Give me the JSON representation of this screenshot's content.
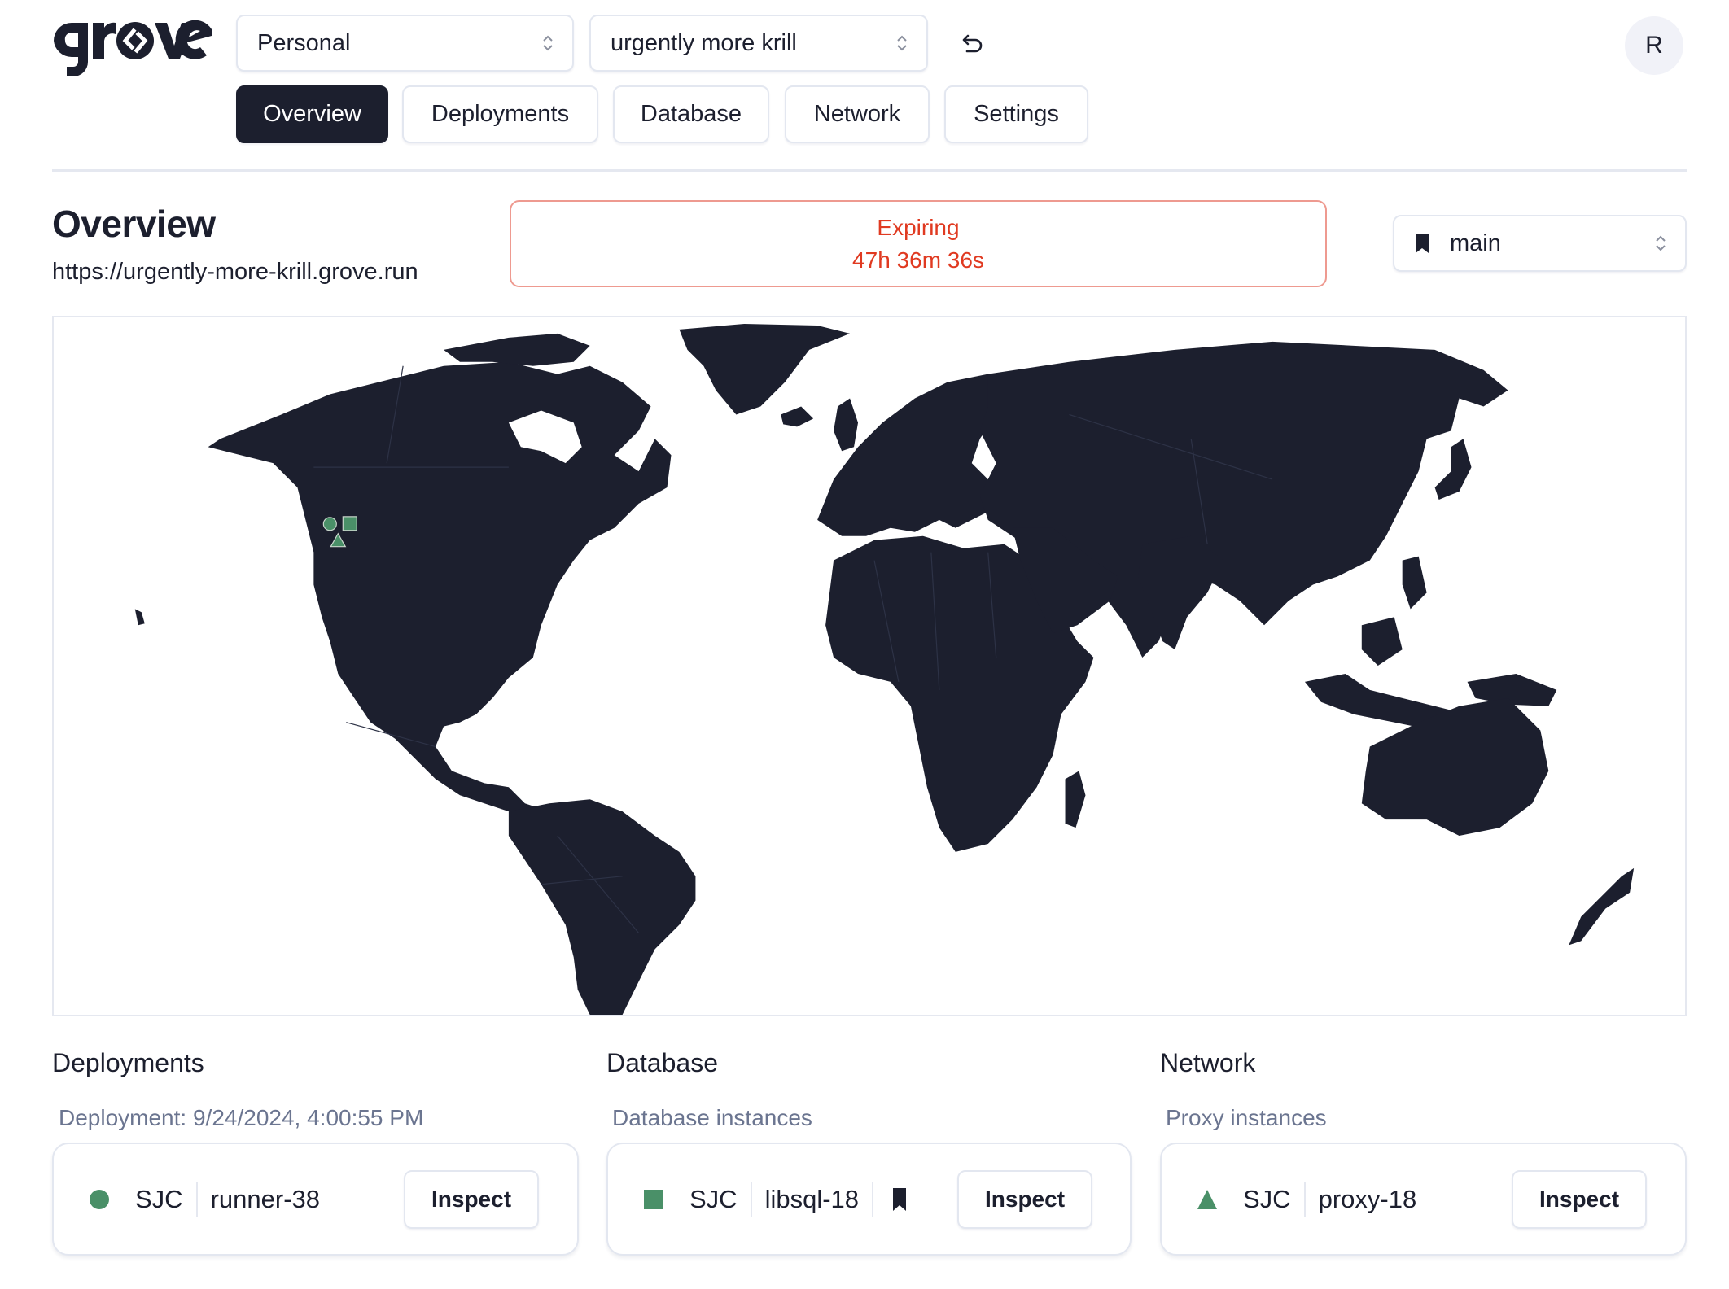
{
  "brand": {
    "name": "grove"
  },
  "header": {
    "workspace_select": {
      "value": "Personal"
    },
    "project_select": {
      "value": "urgently more krill"
    },
    "undo_icon": "undo-arrow-icon",
    "avatar_initial": "R"
  },
  "tabs": [
    {
      "label": "Overview",
      "active": true
    },
    {
      "label": "Deployments",
      "active": false
    },
    {
      "label": "Database",
      "active": false
    },
    {
      "label": "Network",
      "active": false
    },
    {
      "label": "Settings",
      "active": false
    }
  ],
  "overview": {
    "title": "Overview",
    "url": "https://urgently-more-krill.grove.run",
    "expiring": {
      "label": "Expiring",
      "remaining": "47h 36m 36s"
    },
    "branch_select": {
      "value": "main",
      "icon": "bookmark-icon"
    }
  },
  "map": {
    "markers": [
      {
        "type": "circle",
        "kind": "deployment",
        "region": "SJC"
      },
      {
        "type": "square",
        "kind": "database",
        "region": "SJC"
      },
      {
        "type": "triangle",
        "kind": "proxy",
        "region": "SJC"
      }
    ],
    "marker_color": "#4a9068",
    "land_color": "#1c1f2e"
  },
  "sections": {
    "deployments": {
      "title": "Deployments",
      "subtitle": "Deployment: 9/24/2024, 4:00:55 PM",
      "items": [
        {
          "shape": "circle",
          "region": "SJC",
          "name": "runner-38",
          "action": "Inspect"
        }
      ]
    },
    "database": {
      "title": "Database",
      "subtitle": "Database instances",
      "items": [
        {
          "shape": "square",
          "region": "SJC",
          "name": "libsql-18",
          "primary_icon": "bookmark-icon",
          "action": "Inspect"
        }
      ]
    },
    "network": {
      "title": "Network",
      "subtitle": "Proxy instances",
      "items": [
        {
          "shape": "triangle",
          "region": "SJC",
          "name": "proxy-18",
          "action": "Inspect"
        }
      ]
    }
  },
  "colors": {
    "accent_dark": "#1c1f2e",
    "expiring_red": "#e03a21",
    "expiring_border": "#ee9a90",
    "status_green": "#4a9068",
    "muted_text": "#6b7590"
  }
}
